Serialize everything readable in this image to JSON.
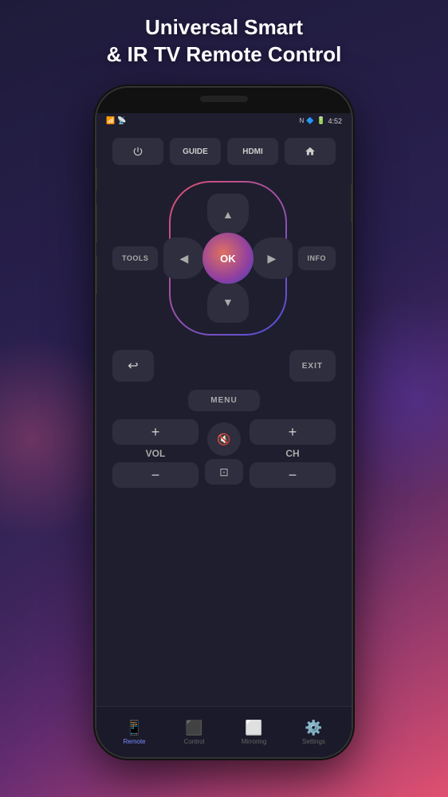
{
  "title": {
    "line1": "Universal Smart",
    "line2": "& IR TV Remote Control"
  },
  "status_bar": {
    "time": "4:52",
    "wifi": "wifi",
    "signal": "signal"
  },
  "top_buttons": [
    {
      "label": "",
      "icon": "power",
      "key": "power"
    },
    {
      "label": "GUIDE",
      "key": "guide"
    },
    {
      "label": "HDMI",
      "key": "hdmi"
    },
    {
      "label": "",
      "icon": "home",
      "key": "home"
    }
  ],
  "side_left": "TOOLS",
  "side_right": "INFO",
  "dpad": {
    "ok_label": "OK",
    "up": "▲",
    "down": "▼",
    "left": "◀",
    "right": "▶"
  },
  "back_label": "↩",
  "exit_label": "EXIT",
  "menu_label": "MENU",
  "vol_plus": "+",
  "vol_label": "VOL",
  "vol_minus": "−",
  "ch_plus": "+",
  "ch_label": "CH",
  "ch_minus": "−",
  "nav": [
    {
      "label": "Remote",
      "icon": "remote",
      "active": true
    },
    {
      "label": "Control",
      "icon": "control",
      "active": false
    },
    {
      "label": "Mirroring",
      "icon": "mirroring",
      "active": false
    },
    {
      "label": "Settings",
      "icon": "settings",
      "active": false
    }
  ],
  "colors": {
    "accent": "#7b8cff",
    "bg": "#1e1e2e",
    "button": "#2e2e3e"
  }
}
